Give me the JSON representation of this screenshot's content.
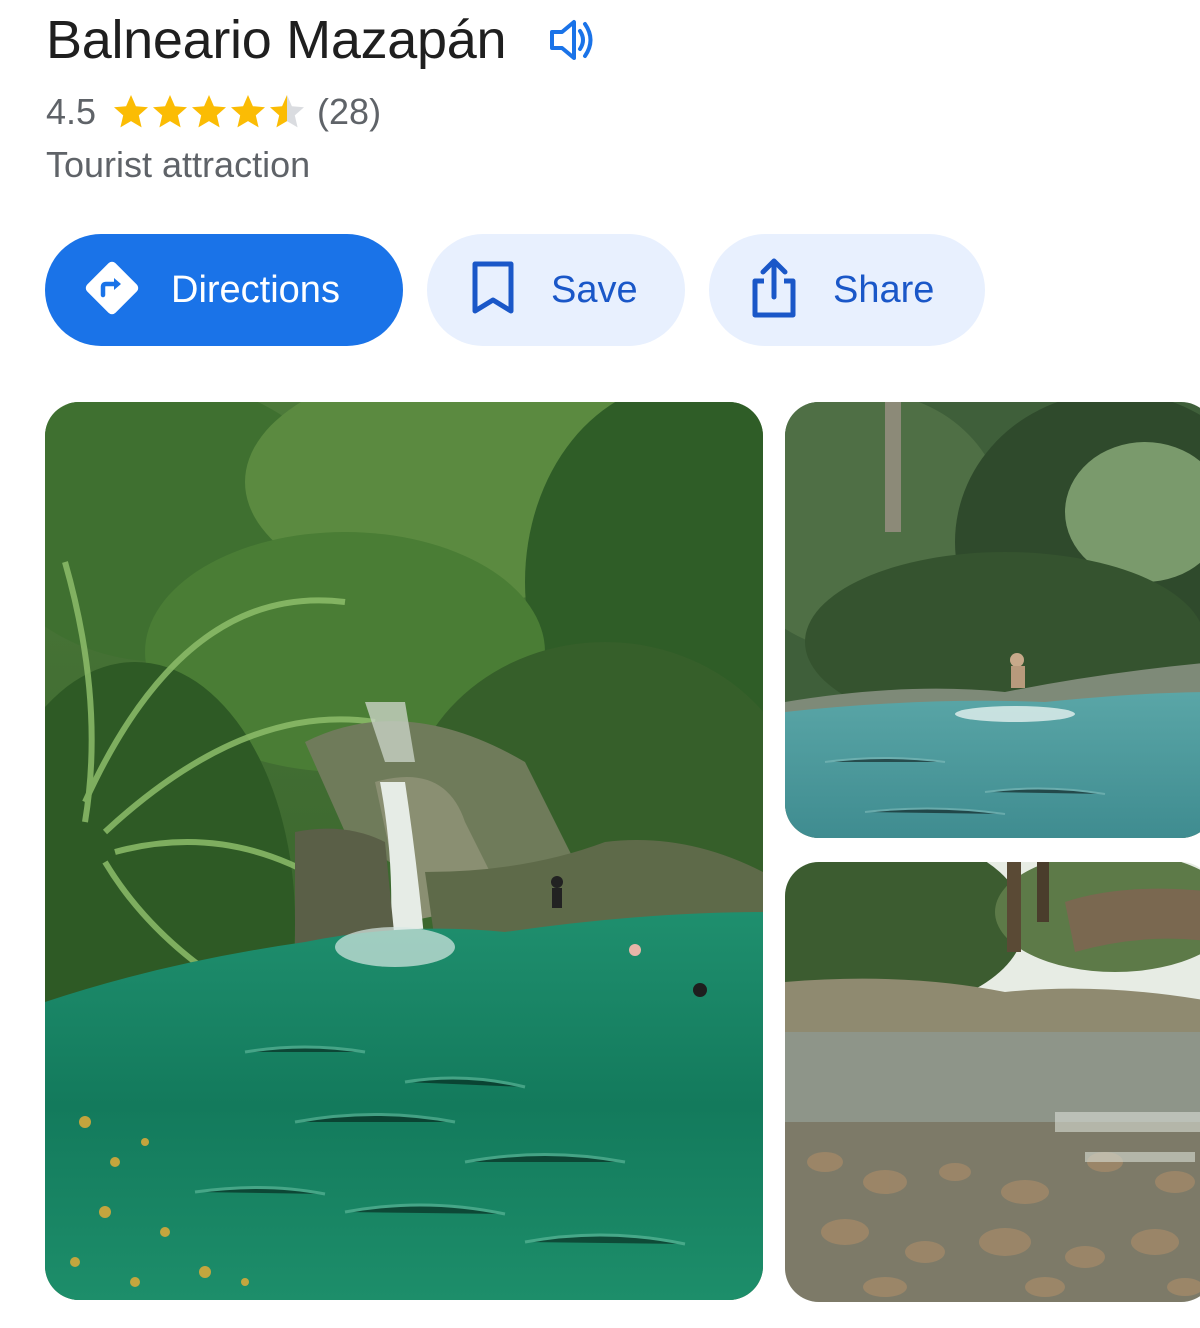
{
  "place": {
    "title": "Balneario Mazapán",
    "rating": "4.5",
    "stars_value": 4.5,
    "stars_max": 5,
    "review_count": "(28)",
    "category": "Tourist attraction"
  },
  "actions": {
    "directions_label": "Directions",
    "save_label": "Save",
    "share_label": "Share"
  },
  "icons": {
    "speaker": "speaker-icon",
    "directions": "directions-icon",
    "save": "bookmark-icon",
    "share": "share-icon"
  },
  "colors": {
    "primary": "#1a73e8",
    "secondary_bg": "#e8f0fe",
    "secondary_text": "#1a57c8",
    "star": "#fbbc04",
    "star_empty": "#dadce0",
    "muted_text": "#5f6368",
    "title_text": "#1f1f1f"
  },
  "photos": [
    {
      "subject": "waterfall-pool-photo"
    },
    {
      "subject": "river-swimmer-photo"
    },
    {
      "subject": "clear-river-rocks-photo"
    }
  ]
}
